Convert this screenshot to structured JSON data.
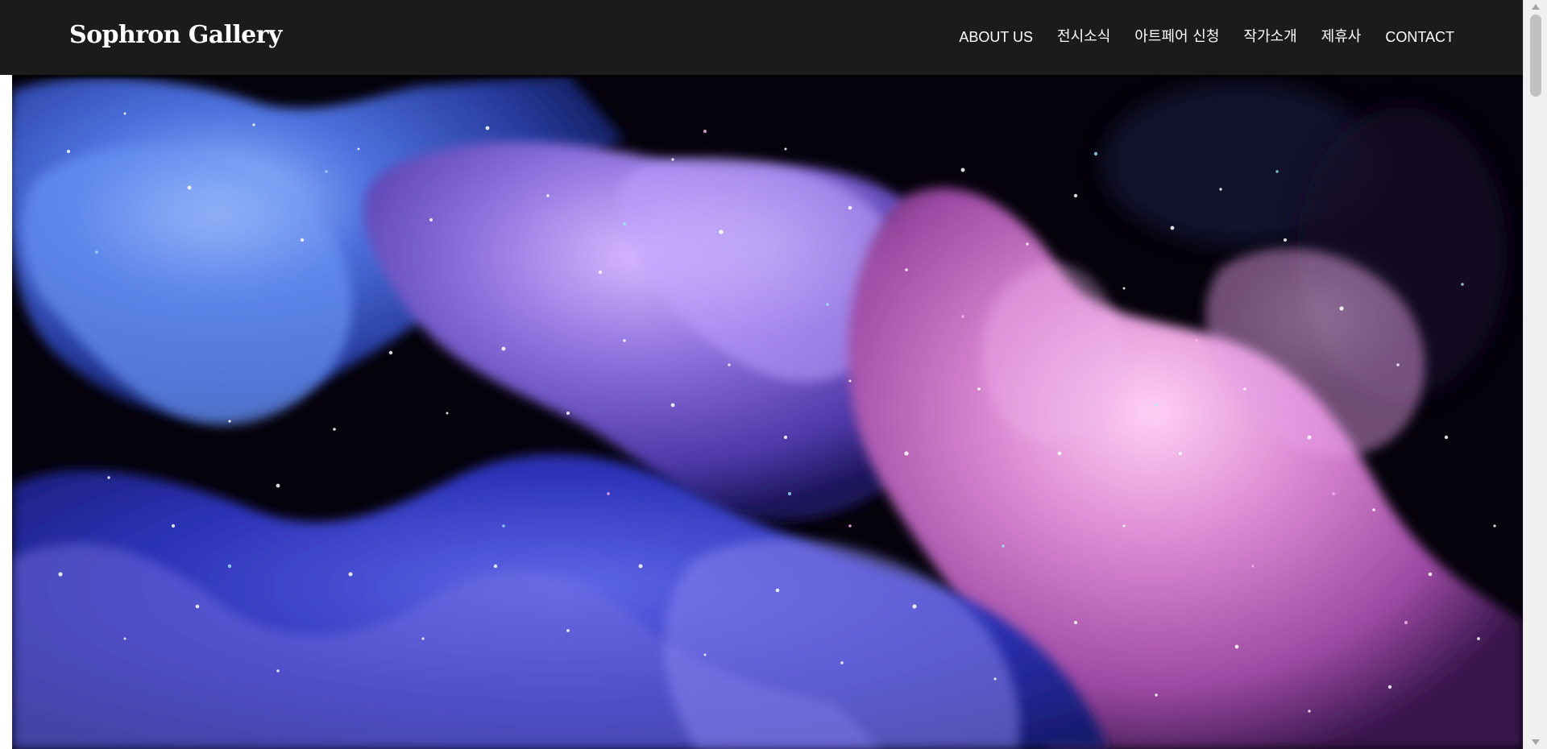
{
  "header": {
    "logo": "Sophron Gallery",
    "nav": [
      {
        "label": "ABOUT US"
      },
      {
        "label": "전시소식"
      },
      {
        "label": "아트페어 신청"
      },
      {
        "label": "작가소개"
      },
      {
        "label": "제휴사"
      },
      {
        "label": "CONTACT"
      }
    ]
  },
  "hero": {
    "media": "abstract-ink-smoke-video",
    "colors": {
      "background": "#05020c",
      "blue": "#3f4fd8",
      "purple": "#7b5ad8",
      "pink": "#d86ab6"
    }
  },
  "colors": {
    "header_bg": "#1b1b1b",
    "header_text": "#ffffff",
    "scrollbar_track": "#f0f0f0",
    "scrollbar_thumb": "#c1c1c1"
  }
}
